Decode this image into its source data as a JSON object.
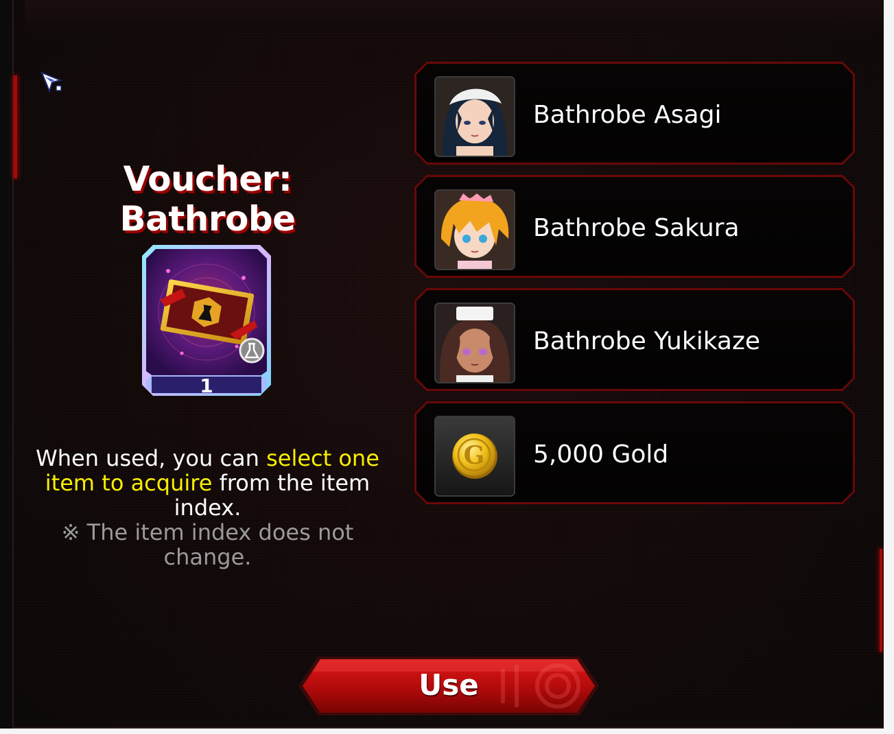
{
  "dialog": {
    "title": "Voucher: Bathrobe",
    "item_quantity": "1",
    "description_parts": [
      "When used, you can ",
      "select one item to acquire",
      " from the item index."
    ],
    "note": "※ The item index does not change."
  },
  "options": [
    {
      "label": "Bathrobe Asagi",
      "icon": "asagi-portrait"
    },
    {
      "label": "Bathrobe Sakura",
      "icon": "sakura-portrait"
    },
    {
      "label": "Bathrobe Yukikaze",
      "icon": "yukikaze-portrait"
    },
    {
      "label": "5,000 Gold",
      "icon": "gold-coin-icon"
    }
  ],
  "use_button": {
    "label": "Use"
  },
  "colors": {
    "accent_red": "#b00a0a",
    "highlight_yellow": "#f7f000",
    "note_gray": "#9b9b9b"
  }
}
